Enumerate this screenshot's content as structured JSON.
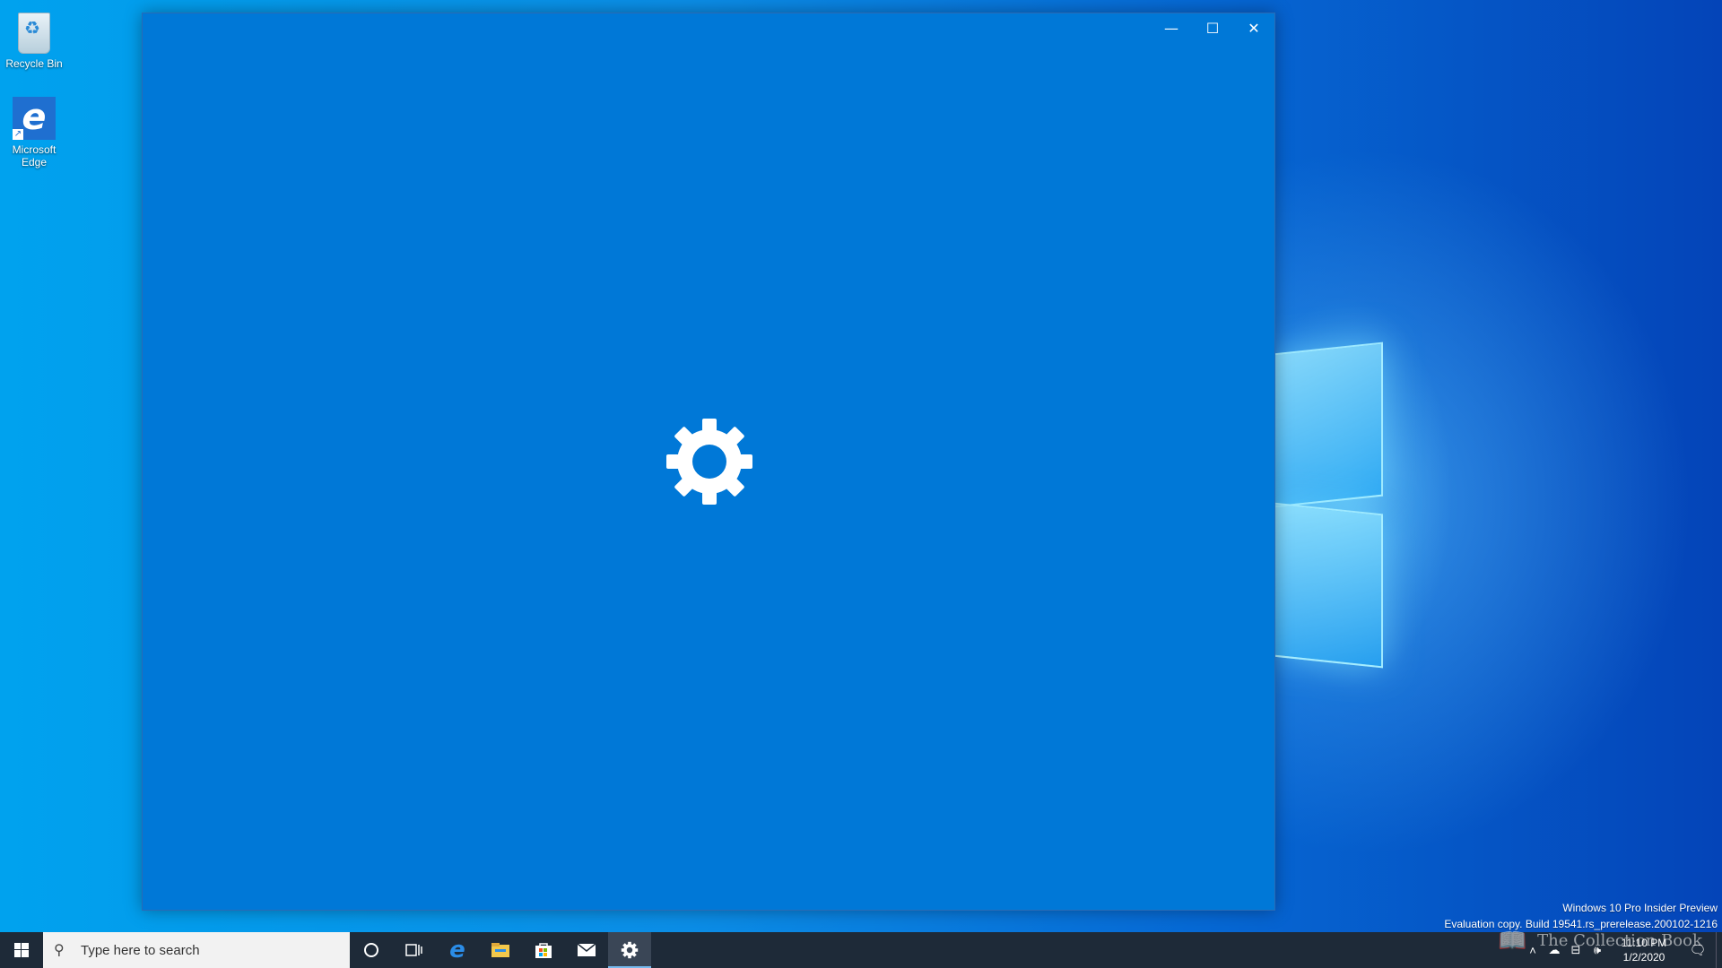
{
  "desktop": {
    "icons": [
      {
        "label": "Recycle Bin",
        "icon": "recycle-bin-icon"
      },
      {
        "label": "Microsoft Edge",
        "icon": "edge-icon"
      }
    ],
    "watermark_line1": "Windows 10 Pro Insider Preview",
    "watermark_line2": "Evaluation copy. Build 19541.rs_prerelease.200102-1216",
    "overlay_text": "The Collection Book"
  },
  "window": {
    "background": "#0078d7",
    "splash_icon": "gear-icon",
    "caption": {
      "minimize": "—",
      "maximize": "☐",
      "close": "✕"
    }
  },
  "taskbar": {
    "search_placeholder": "Type here to search",
    "pinned": [
      "cortana-icon",
      "task-view-icon",
      "edge-icon",
      "file-explorer-icon",
      "store-icon",
      "mail-icon",
      "settings-icon"
    ],
    "active_app": "settings-icon",
    "tray": {
      "time": "11:10 PM",
      "date": "1/2/2020"
    }
  }
}
